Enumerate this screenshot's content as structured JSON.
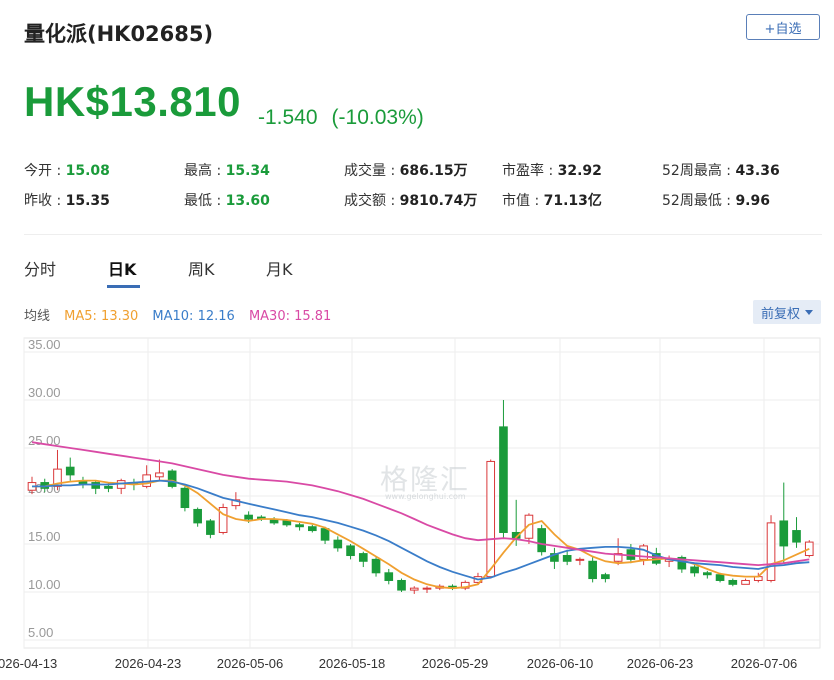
{
  "header": {
    "title": "量化派(HK02685)",
    "watch_button": "+自选"
  },
  "quote": {
    "price": "HK$13.810",
    "change": "-1.540",
    "change_pct": "(-10.03%)",
    "color_down": "#1a9b3a",
    "color_up": "#d9383a"
  },
  "stats": [
    {
      "label": "今开 : ",
      "value": "15.08",
      "green": true
    },
    {
      "label": "最高 : ",
      "value": "15.34",
      "green": true
    },
    {
      "label": "成交量 : ",
      "value": "686.15万",
      "green": false
    },
    {
      "label": "市盈率 : ",
      "value": "32.92",
      "green": false
    },
    {
      "label": "52周最高 : ",
      "value": "43.36",
      "green": false
    },
    {
      "label": "昨收 : ",
      "value": "15.35",
      "green": false
    },
    {
      "label": "最低 : ",
      "value": "13.60",
      "green": true
    },
    {
      "label": "成交额 : ",
      "value": "9810.74万",
      "green": false
    },
    {
      "label": "市值 : ",
      "value": "71.13亿",
      "green": false
    },
    {
      "label": "52周最低 : ",
      "value": "9.96",
      "green": false
    }
  ],
  "tabs": [
    {
      "label": "分时",
      "active": false
    },
    {
      "label": "日K",
      "active": true
    },
    {
      "label": "周K",
      "active": false
    },
    {
      "label": "月K",
      "active": false
    }
  ],
  "legend": {
    "label": "均线",
    "ma5": "MA5: 13.30",
    "ma10": "MA10: 12.16",
    "ma30": "MA30: 15.81",
    "ma5_color": "#f0a030",
    "ma10_color": "#3a7dc9",
    "ma30_color": "#d94aa5"
  },
  "adjust_button": "前复权",
  "watermark": "格隆汇",
  "watermark_sub": "www.gelonghui.com",
  "chart_data": {
    "type": "candlestick",
    "y_ticks": [
      "35.00",
      "30.00",
      "25.00",
      "20.00",
      "15.00",
      "10.00",
      "5.00"
    ],
    "ylim": [
      5,
      35
    ],
    "x_ticks": [
      "2026-04-13",
      "2026-04-23",
      "2026-05-06",
      "2026-05-18",
      "2026-05-29",
      "2026-06-10",
      "2026-06-23",
      "2026-07-06"
    ],
    "grid": true,
    "candles": [
      [
        20.6,
        21.4,
        22.0,
        20.2
      ],
      [
        21.4,
        20.8,
        21.8,
        20.4
      ],
      [
        21.0,
        22.8,
        24.8,
        20.6
      ],
      [
        23.0,
        22.2,
        24.0,
        21.6
      ],
      [
        21.6,
        21.2,
        22.0,
        20.8
      ],
      [
        21.4,
        20.8,
        21.6,
        20.2
      ],
      [
        21.0,
        20.8,
        21.4,
        20.4
      ],
      [
        20.8,
        21.6,
        21.8,
        20.2
      ],
      [
        21.4,
        21.2,
        21.8,
        20.6
      ],
      [
        21.0,
        22.2,
        23.2,
        20.8
      ],
      [
        22.0,
        22.4,
        23.8,
        21.6
      ],
      [
        22.6,
        21.0,
        22.8,
        20.8
      ],
      [
        20.8,
        18.8,
        21.0,
        18.4
      ],
      [
        18.6,
        17.2,
        18.8,
        16.8
      ],
      [
        17.4,
        16.0,
        17.6,
        15.6
      ],
      [
        16.2,
        18.8,
        19.2,
        16.0
      ],
      [
        19.0,
        19.6,
        20.4,
        18.6
      ],
      [
        18.0,
        17.6,
        18.4,
        17.2
      ],
      [
        17.8,
        17.6,
        18.0,
        17.4
      ],
      [
        17.6,
        17.2,
        17.8,
        17.0
      ],
      [
        17.4,
        17.0,
        17.6,
        16.8
      ],
      [
        17.0,
        16.8,
        17.2,
        16.4
      ],
      [
        16.8,
        16.4,
        17.0,
        16.2
      ],
      [
        16.6,
        15.4,
        16.8,
        15.0
      ],
      [
        15.4,
        14.6,
        15.8,
        14.2
      ],
      [
        14.8,
        13.8,
        15.0,
        13.4
      ],
      [
        14.0,
        13.2,
        14.2,
        12.6
      ],
      [
        13.4,
        12.0,
        13.6,
        11.6
      ],
      [
        12.0,
        11.2,
        12.4,
        10.8
      ],
      [
        11.2,
        10.2,
        11.4,
        10.0
      ],
      [
        10.2,
        10.4,
        10.6,
        9.8
      ],
      [
        10.4,
        10.4,
        10.6,
        9.9
      ],
      [
        10.4,
        10.6,
        10.8,
        10.2
      ],
      [
        10.6,
        10.4,
        10.8,
        10.2
      ],
      [
        10.4,
        11.0,
        11.2,
        10.2
      ],
      [
        11.0,
        11.6,
        12.0,
        10.8
      ],
      [
        11.6,
        23.6,
        23.8,
        11.4
      ],
      [
        27.2,
        16.2,
        30.0,
        15.6
      ],
      [
        16.2,
        15.6,
        19.6,
        14.8
      ],
      [
        15.6,
        18.0,
        18.2,
        15.0
      ],
      [
        16.6,
        14.2,
        17.0,
        13.8
      ],
      [
        14.0,
        13.2,
        14.6,
        12.4
      ],
      [
        13.8,
        13.2,
        14.4,
        12.8
      ],
      [
        13.4,
        13.4,
        13.6,
        12.8
      ],
      [
        13.2,
        11.4,
        13.6,
        11.0
      ],
      [
        11.8,
        11.4,
        12.0,
        11.0
      ],
      [
        13.2,
        14.0,
        15.6,
        12.8
      ],
      [
        14.4,
        13.4,
        15.0,
        13.0
      ],
      [
        13.4,
        14.8,
        15.0,
        12.8
      ],
      [
        14.0,
        13.0,
        14.6,
        12.8
      ],
      [
        13.2,
        13.4,
        13.8,
        12.6
      ],
      [
        13.6,
        12.4,
        13.8,
        12.0
      ],
      [
        12.6,
        12.0,
        12.8,
        11.6
      ],
      [
        12.0,
        11.8,
        12.2,
        11.4
      ],
      [
        11.8,
        11.2,
        12.0,
        11.0
      ],
      [
        11.2,
        10.8,
        11.4,
        10.6
      ],
      [
        10.8,
        11.2,
        11.4,
        10.8
      ],
      [
        11.2,
        11.6,
        12.0,
        11.0
      ],
      [
        11.2,
        17.2,
        18.0,
        11.0
      ],
      [
        17.4,
        14.8,
        21.4,
        13.0
      ],
      [
        16.4,
        15.2,
        17.8,
        14.6
      ],
      [
        13.8,
        15.2,
        15.4,
        13.6
      ]
    ],
    "series": [
      {
        "name": "MA5",
        "values": [
          21.0,
          21.0,
          21.3,
          21.5,
          21.6,
          21.6,
          21.4,
          21.3,
          21.2,
          21.3,
          21.6,
          21.6,
          21.1,
          20.3,
          19.2,
          18.1,
          17.6,
          17.4,
          17.6,
          17.6,
          17.5,
          17.3,
          17.1,
          16.7,
          16.0,
          15.3,
          14.5,
          13.7,
          12.9,
          12.0,
          11.3,
          10.8,
          10.5,
          10.4,
          10.5,
          10.8,
          12.4,
          14.1,
          15.7,
          17.0,
          17.4,
          16.0,
          14.8,
          14.4,
          13.7,
          13.2,
          13.0,
          13.1,
          13.3,
          13.4,
          13.5,
          13.3,
          12.9,
          12.4,
          11.9,
          11.7,
          11.6,
          11.6,
          12.9,
          13.3,
          13.9,
          14.5
        ]
      },
      {
        "name": "MA10",
        "values": [
          21.0,
          21.0,
          21.1,
          21.1,
          21.2,
          21.2,
          21.2,
          21.3,
          21.4,
          21.5,
          21.6,
          21.5,
          21.2,
          20.8,
          20.3,
          19.8,
          19.5,
          19.2,
          18.9,
          18.6,
          18.3,
          18.0,
          17.8,
          17.5,
          17.2,
          16.8,
          16.4,
          15.9,
          15.3,
          14.6,
          13.9,
          13.2,
          12.6,
          12.1,
          11.7,
          11.3,
          11.5,
          12.0,
          12.4,
          12.9,
          13.4,
          13.9,
          14.3,
          14.5,
          14.6,
          14.7,
          14.7,
          14.6,
          14.4,
          13.8,
          13.4,
          13.2,
          13.0,
          12.9,
          12.8,
          12.6,
          12.5,
          12.4,
          12.7,
          12.8,
          13.0,
          13.1
        ]
      },
      {
        "name": "MA30",
        "values": [
          25.6,
          25.4,
          25.2,
          25.0,
          24.8,
          24.6,
          24.4,
          24.2,
          24.0,
          23.8,
          23.6,
          23.4,
          23.1,
          22.8,
          22.5,
          22.2,
          22.0,
          21.8,
          21.7,
          21.6,
          21.5,
          21.3,
          21.1,
          20.8,
          20.5,
          20.1,
          19.7,
          19.2,
          18.7,
          18.2,
          17.6,
          17.0,
          16.5,
          16.0,
          15.6,
          15.4,
          15.5,
          15.6,
          15.5,
          15.3,
          15.0,
          14.8,
          14.6,
          14.4,
          14.2,
          14.0,
          13.9,
          13.8,
          13.7,
          13.6,
          13.5,
          13.4,
          13.3,
          13.2,
          13.1,
          13.0,
          12.9,
          12.8,
          12.9,
          13.0,
          13.2,
          13.4
        ]
      }
    ]
  }
}
